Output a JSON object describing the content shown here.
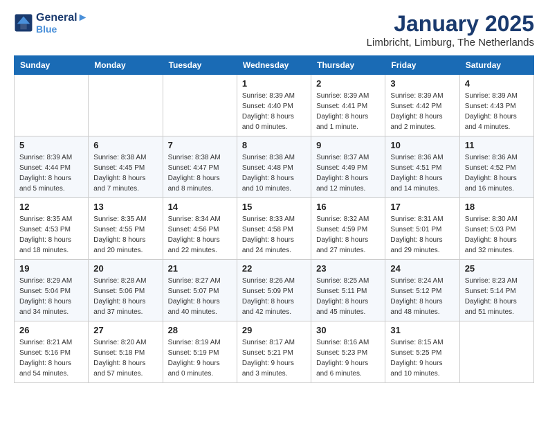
{
  "header": {
    "logo_line1": "General",
    "logo_line2": "Blue",
    "month": "January 2025",
    "location": "Limbricht, Limburg, The Netherlands"
  },
  "weekdays": [
    "Sunday",
    "Monday",
    "Tuesday",
    "Wednesday",
    "Thursday",
    "Friday",
    "Saturday"
  ],
  "weeks": [
    [
      {
        "day": "",
        "detail": ""
      },
      {
        "day": "",
        "detail": ""
      },
      {
        "day": "",
        "detail": ""
      },
      {
        "day": "1",
        "detail": "Sunrise: 8:39 AM\nSunset: 4:40 PM\nDaylight: 8 hours\nand 0 minutes."
      },
      {
        "day": "2",
        "detail": "Sunrise: 8:39 AM\nSunset: 4:41 PM\nDaylight: 8 hours\nand 1 minute."
      },
      {
        "day": "3",
        "detail": "Sunrise: 8:39 AM\nSunset: 4:42 PM\nDaylight: 8 hours\nand 2 minutes."
      },
      {
        "day": "4",
        "detail": "Sunrise: 8:39 AM\nSunset: 4:43 PM\nDaylight: 8 hours\nand 4 minutes."
      }
    ],
    [
      {
        "day": "5",
        "detail": "Sunrise: 8:39 AM\nSunset: 4:44 PM\nDaylight: 8 hours\nand 5 minutes."
      },
      {
        "day": "6",
        "detail": "Sunrise: 8:38 AM\nSunset: 4:45 PM\nDaylight: 8 hours\nand 7 minutes."
      },
      {
        "day": "7",
        "detail": "Sunrise: 8:38 AM\nSunset: 4:47 PM\nDaylight: 8 hours\nand 8 minutes."
      },
      {
        "day": "8",
        "detail": "Sunrise: 8:38 AM\nSunset: 4:48 PM\nDaylight: 8 hours\nand 10 minutes."
      },
      {
        "day": "9",
        "detail": "Sunrise: 8:37 AM\nSunset: 4:49 PM\nDaylight: 8 hours\nand 12 minutes."
      },
      {
        "day": "10",
        "detail": "Sunrise: 8:36 AM\nSunset: 4:51 PM\nDaylight: 8 hours\nand 14 minutes."
      },
      {
        "day": "11",
        "detail": "Sunrise: 8:36 AM\nSunset: 4:52 PM\nDaylight: 8 hours\nand 16 minutes."
      }
    ],
    [
      {
        "day": "12",
        "detail": "Sunrise: 8:35 AM\nSunset: 4:53 PM\nDaylight: 8 hours\nand 18 minutes."
      },
      {
        "day": "13",
        "detail": "Sunrise: 8:35 AM\nSunset: 4:55 PM\nDaylight: 8 hours\nand 20 minutes."
      },
      {
        "day": "14",
        "detail": "Sunrise: 8:34 AM\nSunset: 4:56 PM\nDaylight: 8 hours\nand 22 minutes."
      },
      {
        "day": "15",
        "detail": "Sunrise: 8:33 AM\nSunset: 4:58 PM\nDaylight: 8 hours\nand 24 minutes."
      },
      {
        "day": "16",
        "detail": "Sunrise: 8:32 AM\nSunset: 4:59 PM\nDaylight: 8 hours\nand 27 minutes."
      },
      {
        "day": "17",
        "detail": "Sunrise: 8:31 AM\nSunset: 5:01 PM\nDaylight: 8 hours\nand 29 minutes."
      },
      {
        "day": "18",
        "detail": "Sunrise: 8:30 AM\nSunset: 5:03 PM\nDaylight: 8 hours\nand 32 minutes."
      }
    ],
    [
      {
        "day": "19",
        "detail": "Sunrise: 8:29 AM\nSunset: 5:04 PM\nDaylight: 8 hours\nand 34 minutes."
      },
      {
        "day": "20",
        "detail": "Sunrise: 8:28 AM\nSunset: 5:06 PM\nDaylight: 8 hours\nand 37 minutes."
      },
      {
        "day": "21",
        "detail": "Sunrise: 8:27 AM\nSunset: 5:07 PM\nDaylight: 8 hours\nand 40 minutes."
      },
      {
        "day": "22",
        "detail": "Sunrise: 8:26 AM\nSunset: 5:09 PM\nDaylight: 8 hours\nand 42 minutes."
      },
      {
        "day": "23",
        "detail": "Sunrise: 8:25 AM\nSunset: 5:11 PM\nDaylight: 8 hours\nand 45 minutes."
      },
      {
        "day": "24",
        "detail": "Sunrise: 8:24 AM\nSunset: 5:12 PM\nDaylight: 8 hours\nand 48 minutes."
      },
      {
        "day": "25",
        "detail": "Sunrise: 8:23 AM\nSunset: 5:14 PM\nDaylight: 8 hours\nand 51 minutes."
      }
    ],
    [
      {
        "day": "26",
        "detail": "Sunrise: 8:21 AM\nSunset: 5:16 PM\nDaylight: 8 hours\nand 54 minutes."
      },
      {
        "day": "27",
        "detail": "Sunrise: 8:20 AM\nSunset: 5:18 PM\nDaylight: 8 hours\nand 57 minutes."
      },
      {
        "day": "28",
        "detail": "Sunrise: 8:19 AM\nSunset: 5:19 PM\nDaylight: 9 hours\nand 0 minutes."
      },
      {
        "day": "29",
        "detail": "Sunrise: 8:17 AM\nSunset: 5:21 PM\nDaylight: 9 hours\nand 3 minutes."
      },
      {
        "day": "30",
        "detail": "Sunrise: 8:16 AM\nSunset: 5:23 PM\nDaylight: 9 hours\nand 6 minutes."
      },
      {
        "day": "31",
        "detail": "Sunrise: 8:15 AM\nSunset: 5:25 PM\nDaylight: 9 hours\nand 10 minutes."
      },
      {
        "day": "",
        "detail": ""
      }
    ]
  ]
}
